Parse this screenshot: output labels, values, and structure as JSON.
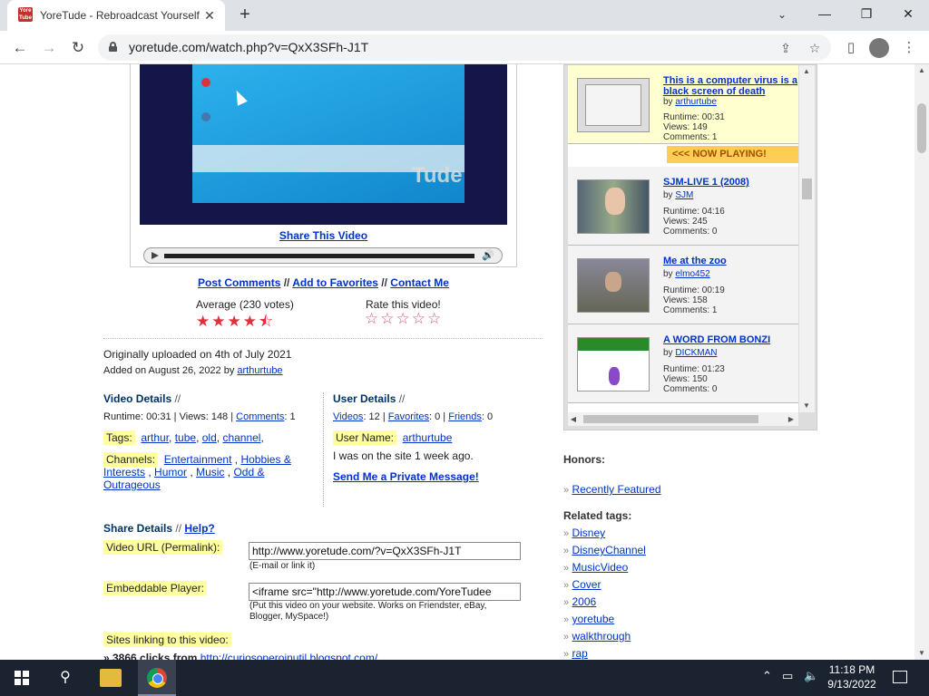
{
  "browser": {
    "tab_title": "YoreTude - Rebroadcast Yourself.",
    "favicon_text": "Yore Tube",
    "url": "yoretude.com/watch.php?v=QxX3SFh-J1T",
    "icons": [
      "back-icon",
      "forward-icon",
      "reload-icon",
      "lock-icon",
      "share-icon",
      "star-icon",
      "sidebar-icon",
      "profile-icon",
      "menu-icon",
      "minimize-icon",
      "maximize-icon",
      "close-icon",
      "tab-search-icon"
    ]
  },
  "player": {
    "watermark": "Tude",
    "share_link": "Share This Video"
  },
  "actions": {
    "post_comments": "Post Comments",
    "sep1": " // ",
    "add_favorites": "Add to Favorites",
    "sep2": " // ",
    "contact": "Contact Me"
  },
  "rating": {
    "average_label": "Average (230 votes)",
    "average_stars": 4.5,
    "rate_label": "Rate this video!",
    "stars_full": "★★★★",
    "stars_half": "⯪",
    "stars_empty": "☆☆☆☆☆"
  },
  "upload": {
    "uploaded_text": "Originally uploaded on 4th of July 2021",
    "added_prefix": "Added on August 26, 2022 by ",
    "added_user": "arthurtube"
  },
  "video_details": {
    "heading": "Video Details",
    "slash": " //",
    "runtime_text": "Runtime: 00:31 | Views: 148 | ",
    "comments_link": "Comments",
    "comments_count": ": 1",
    "tags_label": "Tags:",
    "tags": [
      "arthur",
      "tube",
      "old",
      "channel"
    ],
    "channels_label": "Channels:",
    "channels": [
      "Entertainment",
      "Hobbies & Interests",
      "Humor",
      "Music",
      "Odd & Outrageous"
    ]
  },
  "user_details": {
    "heading": "User Details",
    "slash": " //",
    "videos_link": "Videos",
    "videos_count": ": 12 | ",
    "favorites_link": "Favorites",
    "favorites_count": ": 0 | ",
    "friends_link": "Friends",
    "friends_count": ": 0",
    "username_label": "User Name:",
    "username": "arthurtube",
    "last_seen": "I was on the site 1 week ago.",
    "private_message": "Send Me a Private Message!"
  },
  "share_details": {
    "heading": "Share Details",
    "slash": " // ",
    "help_link": "Help?",
    "url_label": "Video URL (Permalink):",
    "url_value": "http://www.yoretude.com/?v=QxX3SFh-J1T",
    "url_hint": "(E-mail or link it)",
    "embed_label": "Embeddable Player:",
    "embed_value": "<iframe src=\"http://www.yoretude.com/YoreTudee",
    "embed_hint_1": "(Put this video on your website. Works on Friendster, eBay,",
    "embed_hint_2": "Blogger, MySpace!)",
    "sites_label": "Sites linking to this video:",
    "sites_first_prefix": "» 3866 clicks from ",
    "sites_first_link": "http://curiosoperoinutil.blogspot.com/"
  },
  "playlist": {
    "now_playing": "<<< NOW PLAYING!",
    "items": [
      {
        "title": "This is a computer virus is a black screen of death",
        "by": "by ",
        "user": "arthurtube",
        "runtime": "Runtime: 00:31",
        "views": "Views: 149",
        "comments": "Comments: 1"
      },
      {
        "title": "SJM-LIVE 1 (2008)",
        "by": "by ",
        "user": "SJM",
        "runtime": "Runtime: 04:16",
        "views": "Views: 245",
        "comments": "Comments: 0"
      },
      {
        "title": "Me at the zoo",
        "by": "by ",
        "user": "elmo452",
        "runtime": "Runtime: 00:19",
        "views": "Views: 158",
        "comments": "Comments: 1"
      },
      {
        "title": "A WORD FROM BONZI",
        "by": "by ",
        "user": "DICKMAN",
        "runtime": "Runtime: 01:23",
        "views": "Views: 150",
        "comments": "Comments: 0"
      }
    ]
  },
  "sidebar": {
    "honors_label": "Honors:",
    "recently_featured": "Recently Featured",
    "related_label": "Related tags:",
    "related_tags": [
      "Disney",
      "DisneyChannel",
      "MusicVideo",
      "Cover",
      "2006",
      "yoretube",
      "walkthrough",
      "rap"
    ]
  },
  "taskbar": {
    "time": "11:18 PM",
    "date": "9/13/2022",
    "icons": [
      "windows-start-icon",
      "search-icon",
      "file-explorer-icon",
      "chrome-icon",
      "chevron-up-icon",
      "network-icon",
      "volume-icon",
      "notification-icon"
    ]
  }
}
